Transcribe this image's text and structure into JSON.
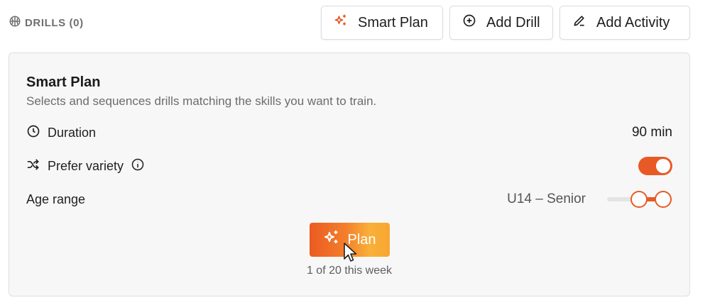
{
  "header": {
    "section_label": "DRILLS (0)",
    "section_icon": "ball-icon",
    "buttons": {
      "smart_plan": {
        "label": "Smart Plan",
        "icon": "sparkles-icon"
      },
      "add_drill": {
        "label": "Add Drill",
        "icon": "plus-circle-icon"
      },
      "add_activity": {
        "label": "Add Activity",
        "icon": "pencil-icon"
      }
    }
  },
  "smart_plan": {
    "title": "Smart Plan",
    "subtitle": "Selects and sequences drills matching the skills you want to train.",
    "duration": {
      "label": "Duration",
      "icon": "clock-icon",
      "value": "90 min"
    },
    "prefer_variety": {
      "label": "Prefer variety",
      "icon": "shuffle-icon",
      "info_icon": "info-icon",
      "enabled": true
    },
    "age_range": {
      "label": "Age range",
      "value": "U14 – Senior"
    },
    "plan_button": {
      "label": "Plan",
      "icon": "sparkles-icon"
    },
    "quota": "1 of 20 this week"
  },
  "colors": {
    "accent": "#e85a25",
    "gradient_start": "#eb5a23",
    "gradient_end": "#f9b03a"
  }
}
